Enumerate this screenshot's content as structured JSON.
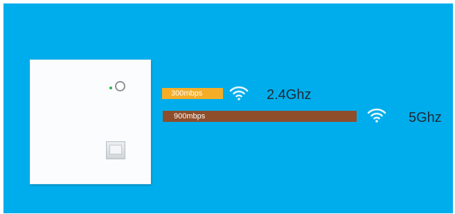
{
  "colors": {
    "background": "#00adec",
    "bar_24ghz": "#f5ad28",
    "bar_5ghz": "#8e4e2c",
    "led": "#2db34a"
  },
  "device": {
    "icons": [
      "led-indicator-icon",
      "power-button-icon",
      "ethernet-port-icon"
    ]
  },
  "bands": [
    {
      "speed": "300mbps",
      "label": "2.4Ghz",
      "icon": "wifi-icon"
    },
    {
      "speed": "900mbps",
      "label": "5Ghz",
      "icon": "wifi-icon"
    }
  ]
}
